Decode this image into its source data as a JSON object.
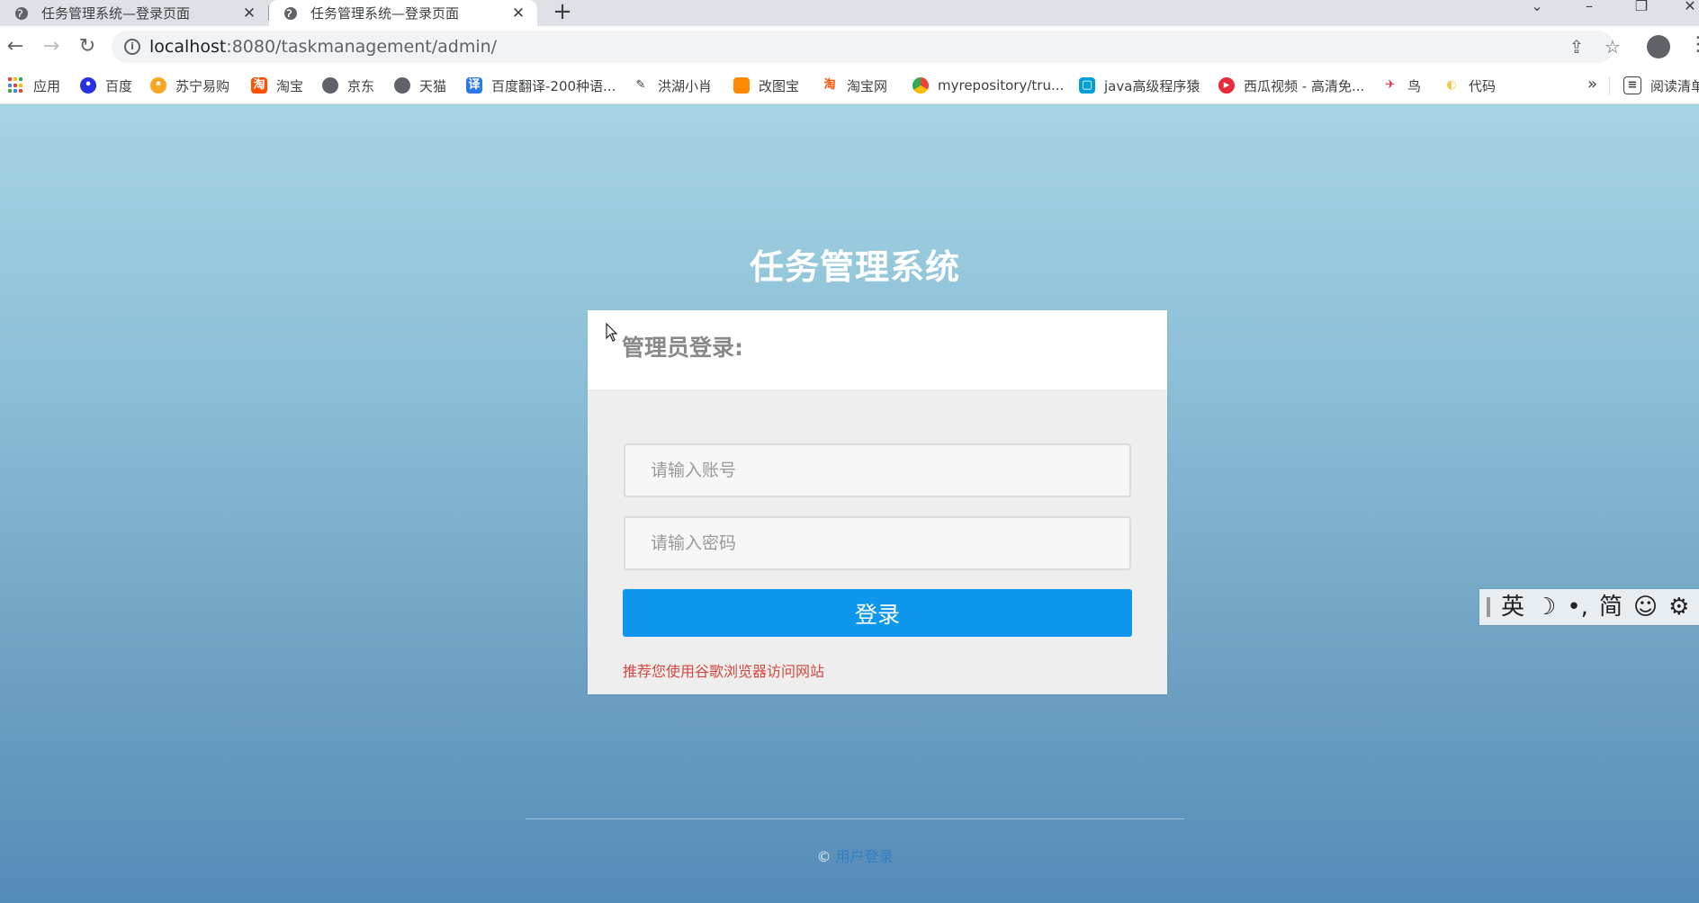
{
  "browser": {
    "tabs": [
      {
        "title": "任务管理系统—登录页面",
        "active": false
      },
      {
        "title": "任务管理系统—登录页面",
        "active": true
      }
    ],
    "new_tab": "+",
    "url_host": "localhost",
    "url_path": ":8080/taskmanagement/admin/",
    "bookmarks": [
      {
        "label": "应用"
      },
      {
        "label": "百度"
      },
      {
        "label": "苏宁易购"
      },
      {
        "label": "淘宝"
      },
      {
        "label": "京东"
      },
      {
        "label": "天猫"
      },
      {
        "label": "百度翻译-200种语..."
      },
      {
        "label": "洪湖小肖"
      },
      {
        "label": "改图宝"
      },
      {
        "label": "淘宝网"
      },
      {
        "label": "myrepository/tru..."
      },
      {
        "label": "java高级程序猿"
      },
      {
        "label": "西瓜视频 - 高清免..."
      },
      {
        "label": "鸟"
      },
      {
        "label": "代码"
      }
    ],
    "more_bookmarks": "»",
    "reading_list": "阅读清单"
  },
  "page": {
    "title": "任务管理系统",
    "login_heading": "管理员登录:",
    "account_placeholder": "请输入账号",
    "password_placeholder": "请输入密码",
    "login_button": "登录",
    "tip": "推荐您使用谷歌浏览器访问网站",
    "footer_symbol": "©",
    "footer_link": "用户登录"
  },
  "ime": {
    "items": [
      "英",
      "☽",
      "•,",
      "简",
      "☺",
      "⚙"
    ]
  },
  "colors": {
    "button": "#0f97ee",
    "tip": "#d6473f",
    "bg_top": "#a5d4e4",
    "bg_bottom": "#558bb8"
  }
}
